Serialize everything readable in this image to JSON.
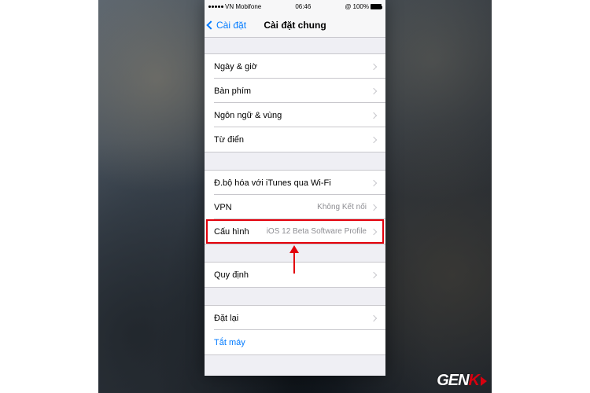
{
  "status": {
    "carrier": "VN Mobifone",
    "time": "06:46",
    "battery_pct": "100%"
  },
  "nav": {
    "back": "Cài đặt",
    "title": "Cài đặt chung"
  },
  "groups": [
    {
      "rows": [
        {
          "label": "Ngày & giờ",
          "value": ""
        },
        {
          "label": "Bàn phím",
          "value": ""
        },
        {
          "label": "Ngôn ngữ & vùng",
          "value": ""
        },
        {
          "label": "Từ điển",
          "value": ""
        }
      ]
    },
    {
      "rows": [
        {
          "label": "Đ.bộ hóa với iTunes qua Wi-Fi",
          "value": ""
        },
        {
          "label": "VPN",
          "value": "Không Kết nối"
        },
        {
          "label": "Cấu hình",
          "value": "iOS 12 Beta Software Profile",
          "highlighted": true
        }
      ]
    },
    {
      "rows": [
        {
          "label": "Quy định",
          "value": ""
        }
      ]
    },
    {
      "rows": [
        {
          "label": "Đặt lại",
          "value": ""
        },
        {
          "label": "Tắt máy",
          "value": "",
          "action": true,
          "no_chevron": true
        }
      ]
    }
  ],
  "watermark": {
    "gen": "GEN",
    "k": "K"
  }
}
